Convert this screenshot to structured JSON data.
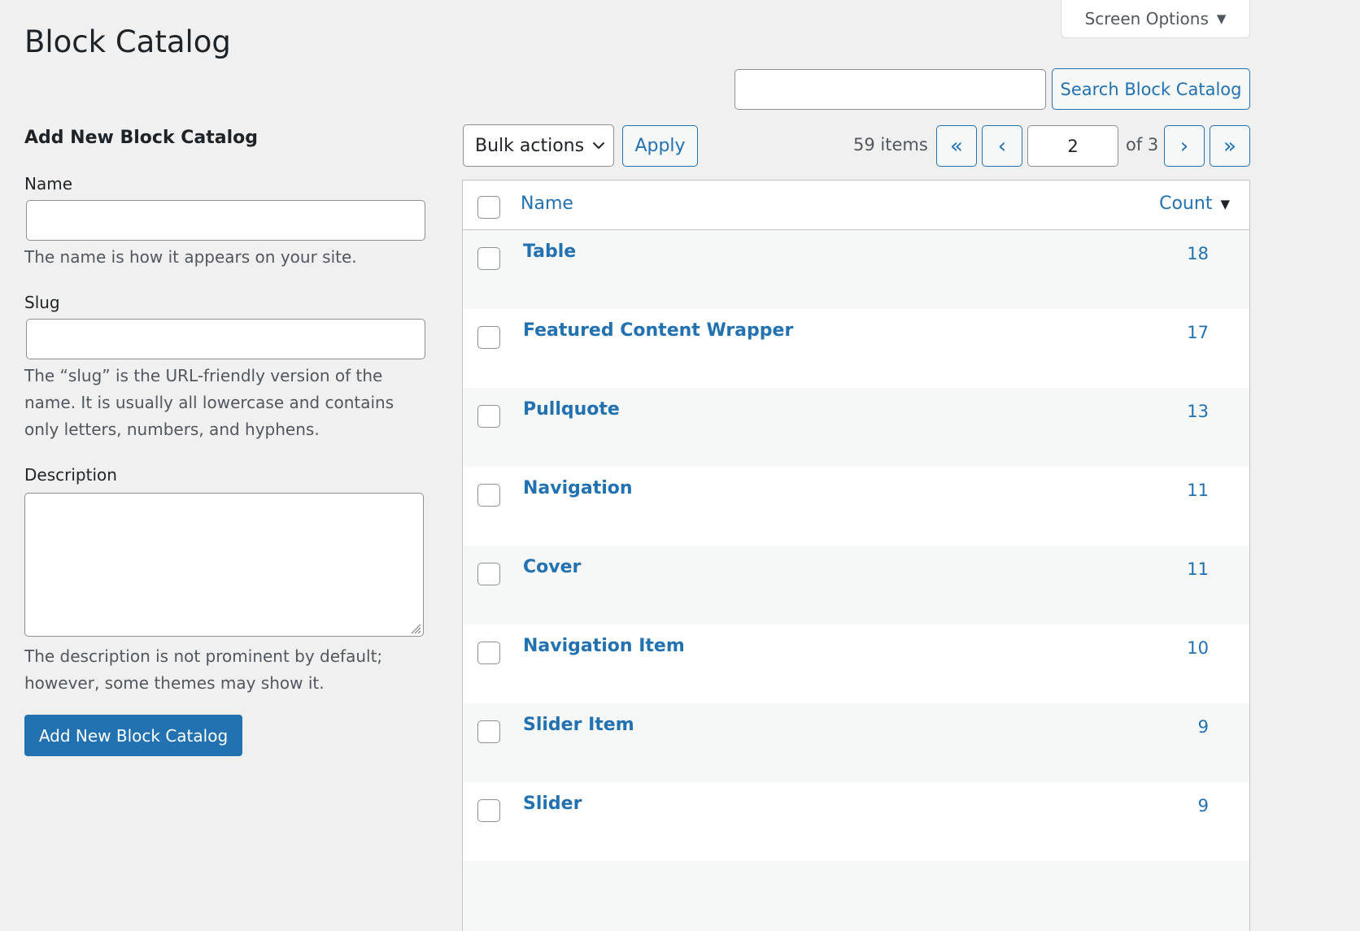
{
  "screen_options": {
    "label": "Screen Options"
  },
  "page": {
    "title": "Block Catalog"
  },
  "search": {
    "value": "",
    "button_label": "Search Block Catalog"
  },
  "form": {
    "heading": "Add New Block Catalog",
    "name_label": "Name",
    "name_value": "",
    "name_hint": "The name is how it appears on your site.",
    "slug_label": "Slug",
    "slug_value": "",
    "slug_hint": "The “slug” is the URL-friendly version of the name. It is usually all lowercase and contains only letters, numbers, and hyphens.",
    "description_label": "Description",
    "description_value": "",
    "description_hint": "The description is not prominent by default; however, some themes may show it.",
    "submit_label": "Add New Block Catalog"
  },
  "toolbar": {
    "bulk_actions": "Bulk actions",
    "apply_label": "Apply",
    "items_count": "59 items",
    "first_page": "«",
    "prev_page": "‹",
    "current_page": "2",
    "total_pages_label": "of 3",
    "next_page": "›",
    "last_page": "»"
  },
  "table": {
    "columns": {
      "name": "Name",
      "count": "Count"
    },
    "rows": [
      {
        "name": "Table",
        "count": "18"
      },
      {
        "name": "Featured Content Wrapper",
        "count": "17"
      },
      {
        "name": "Pullquote",
        "count": "13"
      },
      {
        "name": "Navigation",
        "count": "11"
      },
      {
        "name": "Cover",
        "count": "11"
      },
      {
        "name": "Navigation Item",
        "count": "10"
      },
      {
        "name": "Slider Item",
        "count": "9"
      },
      {
        "name": "Slider",
        "count": "9"
      }
    ]
  },
  "colors": {
    "accent": "#2271b1",
    "background": "#f0f0f1",
    "row_alt": "#f6f7f7"
  },
  "icons": {
    "screen_options_caret": "caret-down-icon",
    "bulk_caret": "chevron-down-icon",
    "sort_caret": "sort-desc-icon"
  }
}
